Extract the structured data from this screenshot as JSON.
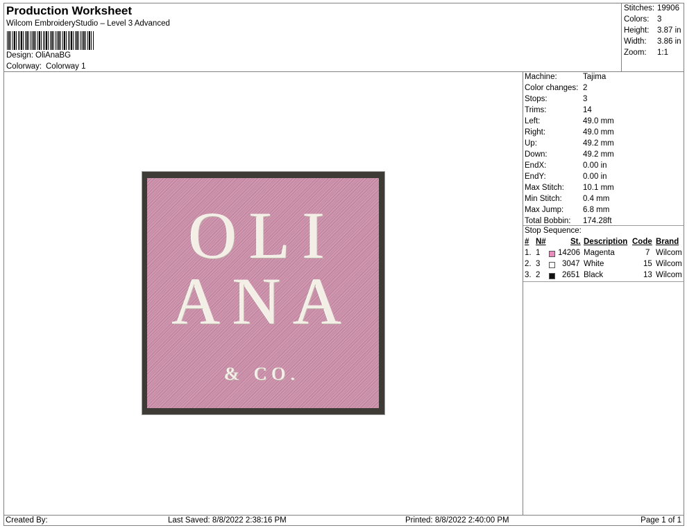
{
  "header": {
    "title": "Production Worksheet",
    "subtitle": "Wilcom EmbroideryStudio – Level 3 Advanced",
    "design_label": "Design:",
    "design_value": "OliAnaBG",
    "colorway_label": "Colorway:",
    "colorway_value": "Colorway 1"
  },
  "summary": {
    "stitches_label": "Stitches:",
    "stitches_value": "19906",
    "colors_label": "Colors:",
    "colors_value": "3",
    "height_label": "Height:",
    "height_value": "3.87 in",
    "width_label": "Width:",
    "width_value": "3.86 in",
    "zoom_label": "Zoom:",
    "zoom_value": "1:1"
  },
  "specs": [
    {
      "label": "Machine:",
      "value": "Tajima"
    },
    {
      "label": "Color changes:",
      "value": "2"
    },
    {
      "label": "Stops:",
      "value": "3"
    },
    {
      "label": "Trims:",
      "value": "14"
    },
    {
      "label": "Left:",
      "value": "49.0 mm"
    },
    {
      "label": "Right:",
      "value": "49.0 mm"
    },
    {
      "label": "Up:",
      "value": "49.2 mm"
    },
    {
      "label": "Down:",
      "value": "49.2 mm"
    },
    {
      "label": "EndX:",
      "value": "0.00 in"
    },
    {
      "label": "EndY:",
      "value": "0.00 in"
    },
    {
      "label": "Max Stitch:",
      "value": "10.1 mm"
    },
    {
      "label": "Min Stitch:",
      "value": "0.4 mm"
    },
    {
      "label": "Max Jump:",
      "value": "6.8 mm"
    },
    {
      "label": "Total Bobbin:",
      "value": "174.28ft"
    }
  ],
  "stop_sequence": {
    "title": "Stop Sequence:",
    "columns": {
      "num": "#",
      "n": "N#",
      "st": "St.",
      "desc": "Description",
      "code": "Code",
      "brand": "Brand"
    },
    "rows": [
      {
        "num": "1.",
        "n": "1",
        "color": "#e98bbd",
        "st": "14206",
        "desc": "Magenta",
        "code": "7",
        "brand": "Wilcom"
      },
      {
        "num": "2.",
        "n": "3",
        "color": "#ffffff",
        "st": "3047",
        "desc": "White",
        "code": "15",
        "brand": "Wilcom"
      },
      {
        "num": "3.",
        "n": "2",
        "color": "#111111",
        "st": "2651",
        "desc": "Black",
        "code": "13",
        "brand": "Wilcom"
      }
    ]
  },
  "design": {
    "line1": "OLI",
    "line2": "ANA",
    "line3": "& CO."
  },
  "footer": {
    "created_by": "Created By:",
    "last_saved": "Last Saved: 8/8/2022 2:38:16 PM",
    "printed": "Printed: 8/8/2022 2:40:00 PM",
    "page": "Page 1 of 1"
  }
}
